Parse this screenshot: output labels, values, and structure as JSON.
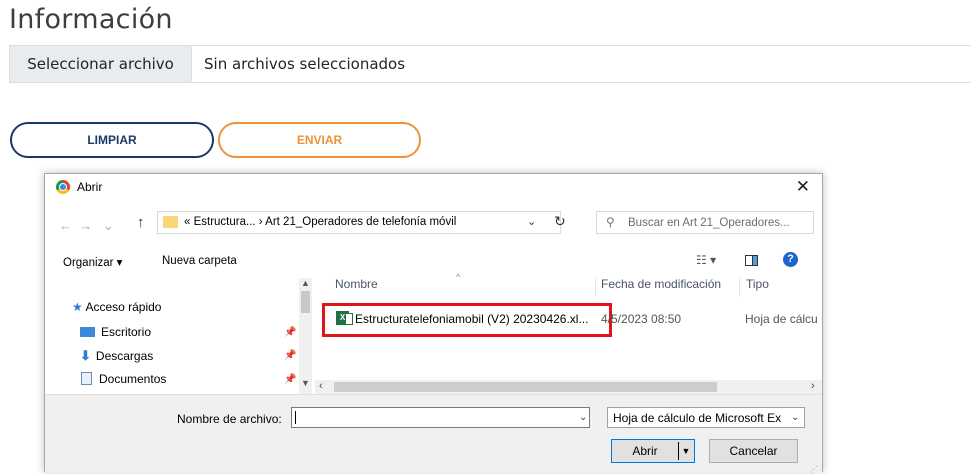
{
  "page": {
    "title": "Información",
    "file_button": "Seleccionar archivo",
    "file_status": "Sin archivos seleccionados",
    "clear_button": "LIMPIAR",
    "send_button": "ENVIAR"
  },
  "colors": {
    "clear_button": "#1d3a66",
    "send_button": "#f0923a",
    "highlight": "#e0141c"
  },
  "dialog": {
    "title": "Abrir",
    "close": "✕",
    "breadcrumb": "« Estructura...  ›  Art 21_Operadores de telefonía móvil",
    "search_placeholder": "Buscar en Art 21_Operadores...",
    "toolbar": {
      "organize": "Organizar ▾",
      "new_folder": "Nueva carpeta",
      "help": "?"
    },
    "nav": {
      "quick_access": "Acceso rápido",
      "items": [
        "Escritorio",
        "Descargas",
        "Documentos"
      ]
    },
    "columns": {
      "name": "Nombre",
      "modified": "Fecha de modificación",
      "type": "Tipo"
    },
    "files": [
      {
        "name": "Estructuratelefoniamobil (V2) 20230426.xl...",
        "modified": "4/5/2023 08:50",
        "type": "Hoja de cálcu"
      }
    ],
    "filename_label": "Nombre de archivo:",
    "filename_value": "",
    "filetype_value": "Hoja de cálculo de Microsoft Ex",
    "open_button": "Abrir",
    "cancel_button": "Cancelar"
  }
}
